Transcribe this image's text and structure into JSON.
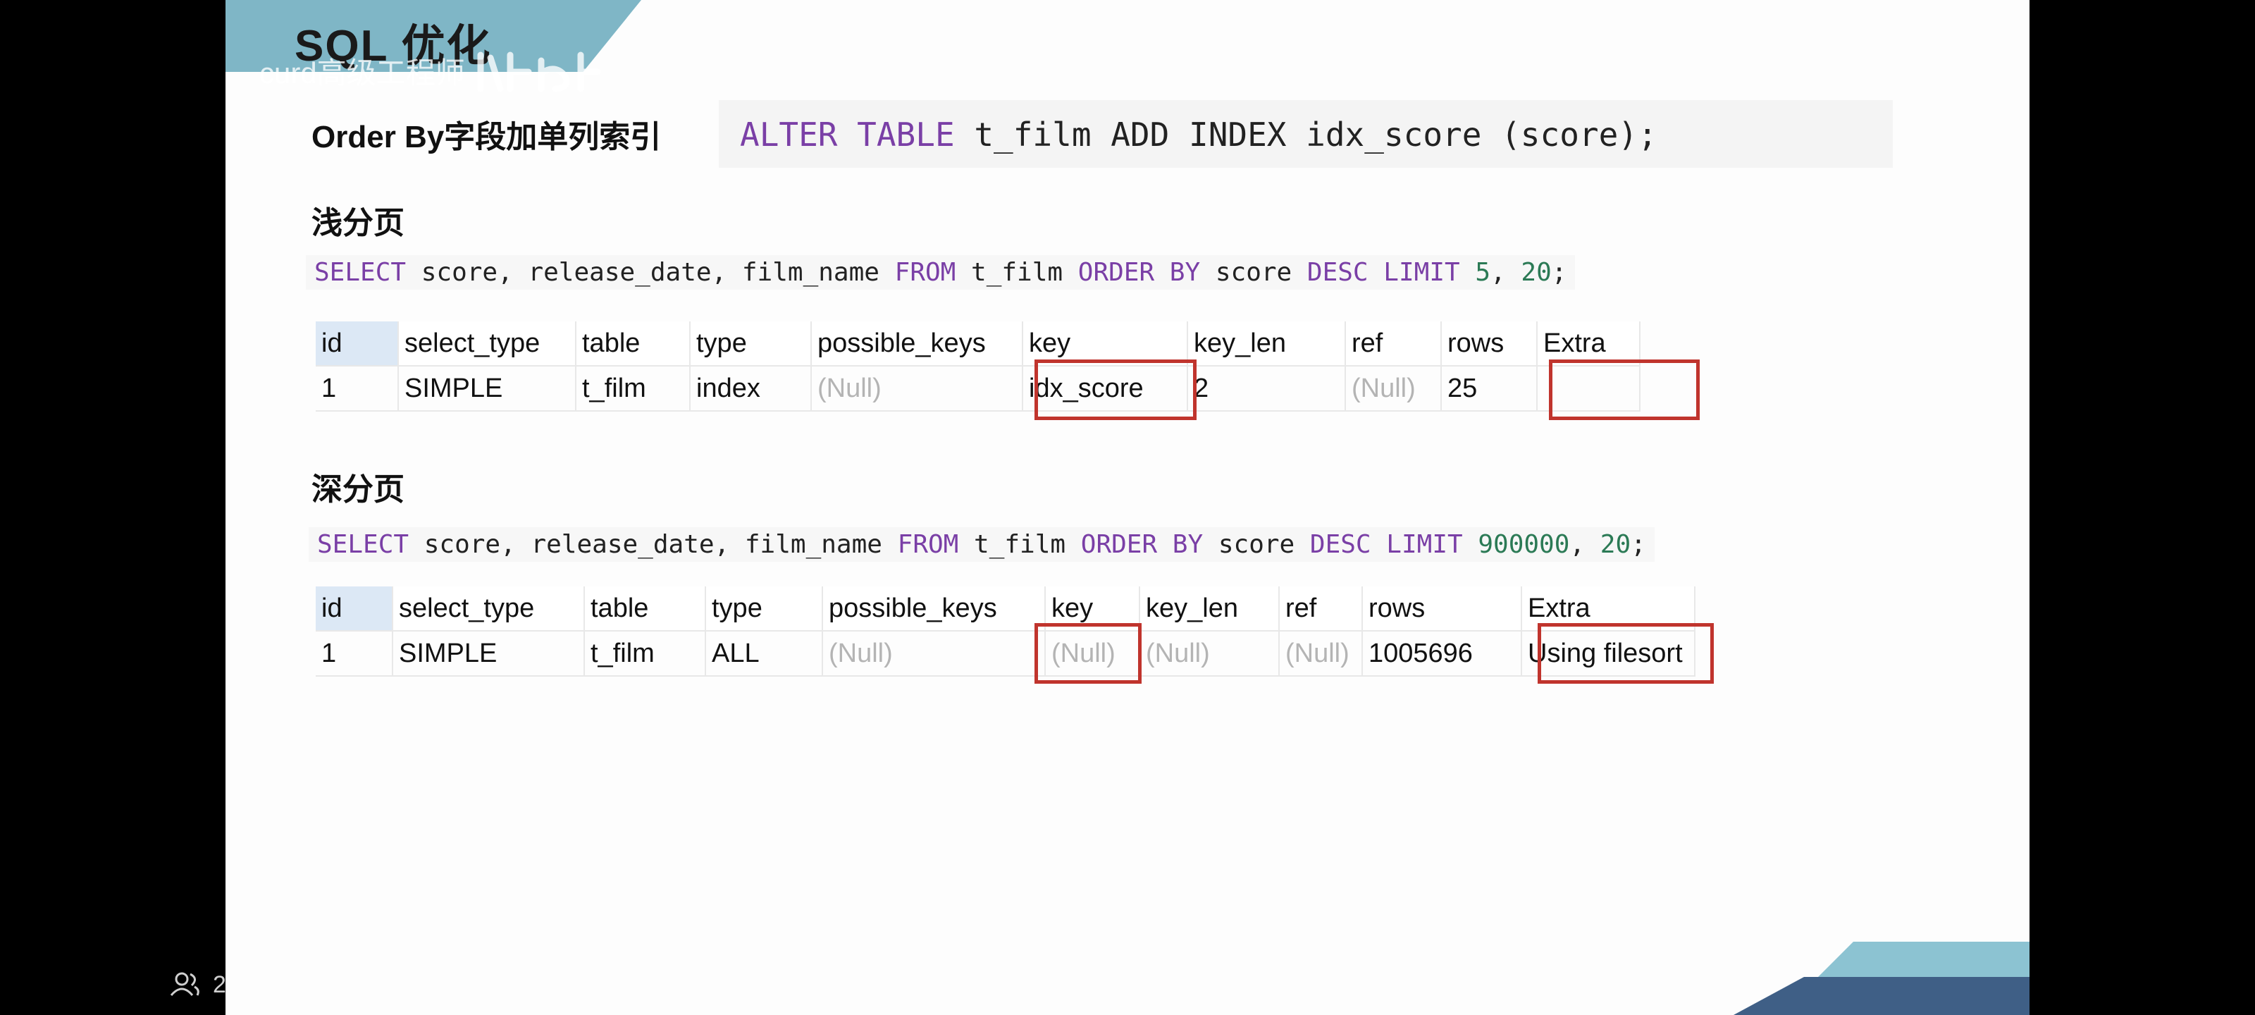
{
  "slide": {
    "title": "SQL 优化",
    "watermark": "curd高级工程师",
    "orderby_label": "Order By字段加单列索引",
    "alter_sql": {
      "kw1": "ALTER TABLE",
      "tbl": "t_film",
      "kw2": "ADD INDEX",
      "rest": "idx_score (score);"
    },
    "shallow": {
      "heading": "浅分页",
      "sql": {
        "kw_select": "SELECT",
        "cols": "score, release_date, film_name",
        "kw_from": "FROM",
        "tbl": "t_film",
        "kw_order": "ORDER BY",
        "col": "score",
        "kw_desc": "DESC",
        "kw_limit": "LIMIT",
        "offset": "5",
        "comma": ",",
        "count": "20",
        "semi": ";"
      },
      "headers": [
        "id",
        "select_type",
        "table",
        "type",
        "possible_keys",
        "key",
        "key_len",
        "ref",
        "rows",
        "Extra"
      ],
      "row": [
        "1",
        "SIMPLE",
        "t_film",
        "index",
        "(Null)",
        "idx_score",
        "2",
        "(Null)",
        "25",
        ""
      ]
    },
    "deep": {
      "heading": "深分页",
      "sql": {
        "kw_select": "SELECT",
        "cols": "score, release_date, film_name",
        "kw_from": "FROM",
        "tbl": "t_film",
        "kw_order": "ORDER BY",
        "col": "score",
        "kw_desc": "DESC",
        "kw_limit": "LIMIT",
        "offset": "900000",
        "comma": ",",
        "count": "20",
        "semi": ";"
      },
      "headers": [
        "id",
        "select_type",
        "table",
        "type",
        "possible_keys",
        "key",
        "key_len",
        "ref",
        "rows",
        "Extra"
      ],
      "row": [
        "1",
        "SIMPLE",
        "t_film",
        "ALL",
        "(Null)",
        "(Null)",
        "(Null)",
        "(Null)",
        "1005696",
        "Using filesort"
      ]
    }
  },
  "viewer": {
    "user_count": "2"
  },
  "colors": {
    "keyword": "#7a3fa6",
    "number": "#2b7a55",
    "highlight": "#c0342d",
    "banner": "#7fb6c6",
    "null_text": "#b4b4b4"
  }
}
